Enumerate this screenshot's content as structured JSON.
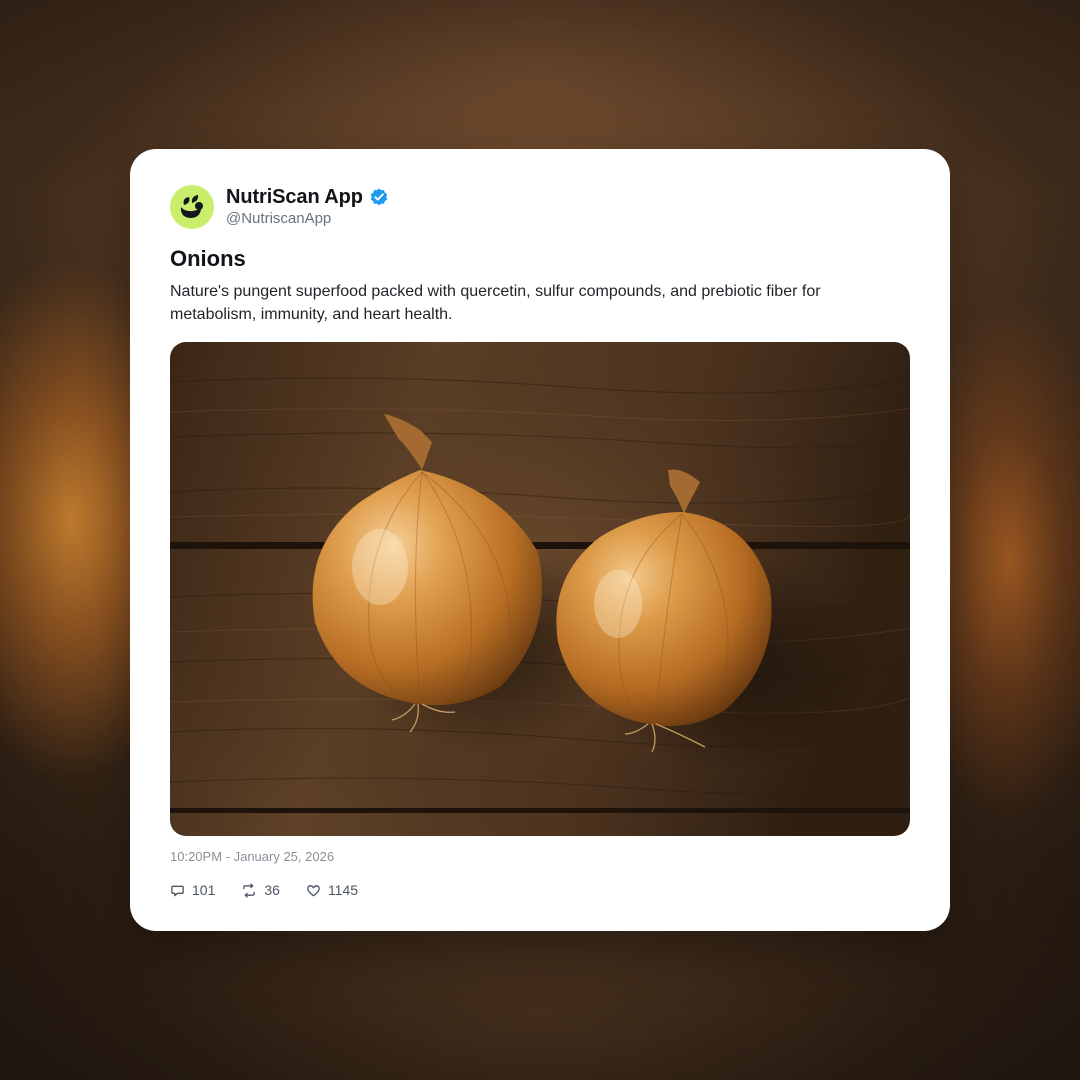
{
  "post": {
    "author": {
      "name": "NutriScan App",
      "handle": "@NutriscanApp",
      "verified": true,
      "avatar_color": "#c8ef6b"
    },
    "title": "Onions",
    "description": "Nature's pungent superfood packed with quercetin, sulfur compounds, and prebiotic fiber for metabolism, immunity, and heart health.",
    "image": {
      "subject": "two-yellow-onions-on-wooden-table"
    },
    "timestamp": "10:20PM - January 25, 2026",
    "stats": {
      "replies": "101",
      "reposts": "36",
      "likes": "1145"
    }
  },
  "colors": {
    "verified_badge": "#1d9bf0",
    "text_primary": "#111418",
    "text_muted": "#6b7280"
  },
  "icons": {
    "reply": "reply-icon",
    "repost": "repost-icon",
    "like": "heart-icon",
    "verified": "verified-badge-icon"
  }
}
